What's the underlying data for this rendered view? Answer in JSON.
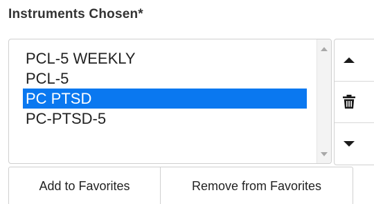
{
  "section": {
    "title": "Instruments Chosen*"
  },
  "listbox": {
    "items": [
      {
        "label": "PCL-5 WEEKLY",
        "selected": false
      },
      {
        "label": "PCL-5",
        "selected": false
      },
      {
        "label": "PC PTSD",
        "selected": true
      },
      {
        "label": "PC-PTSD-5",
        "selected": false
      }
    ],
    "selection_color": "#0a78f0"
  },
  "side_controls": {
    "move_up_icon": "triangle-up-icon",
    "delete_icon": "trash-icon",
    "move_down_icon": "triangle-down-icon"
  },
  "favorites": {
    "add_label": "Add to Favorites",
    "remove_label": "Remove from Favorites"
  }
}
